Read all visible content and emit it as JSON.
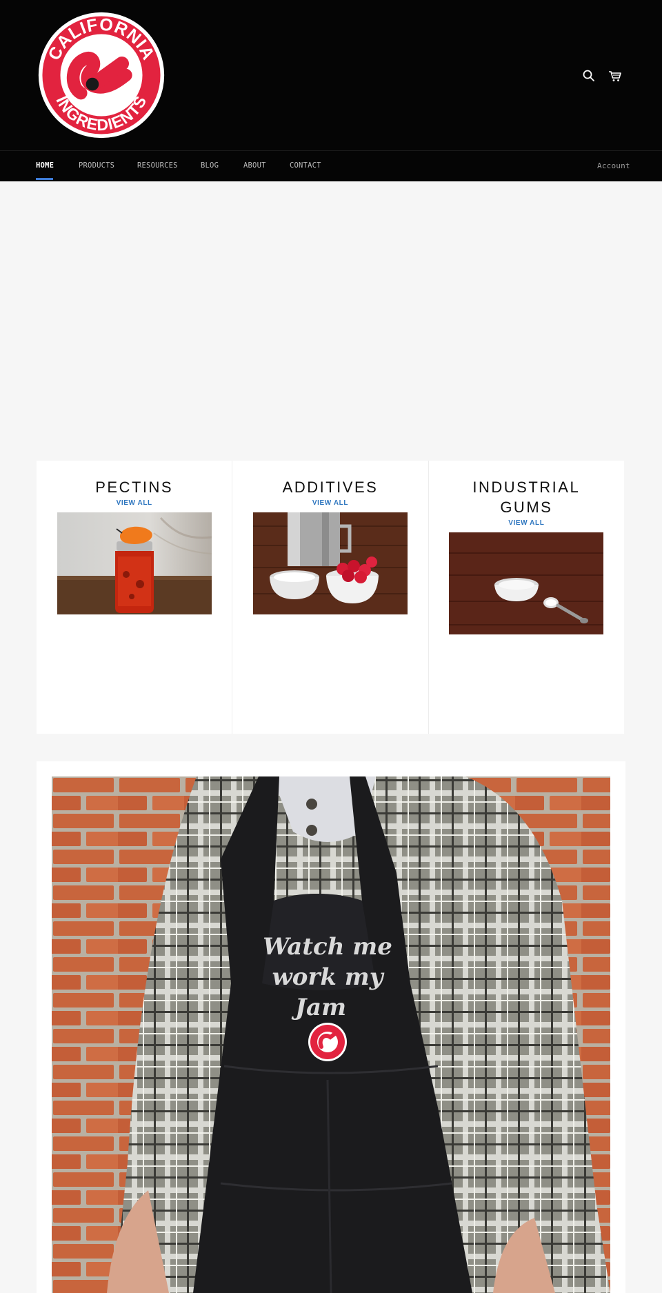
{
  "header": {
    "logo_alt": "California Ingredients",
    "logo_text_top": "CALIFORNIA",
    "logo_text_bottom": "INGREDIENTS",
    "icons": [
      "search-icon",
      "cart-icon"
    ]
  },
  "nav": {
    "items": [
      {
        "label": "HOME",
        "active": true
      },
      {
        "label": "PRODUCTS"
      },
      {
        "label": "RESOURCES"
      },
      {
        "label": "BLOG"
      },
      {
        "label": "ABOUT"
      },
      {
        "label": "CONTACT"
      }
    ],
    "account": "Account"
  },
  "collections": [
    {
      "title": "PECTINS",
      "link": "VIEW ALL"
    },
    {
      "title": "ADDITIVES",
      "link": "VIEW ALL"
    },
    {
      "title": "INDUSTRIAL GUMS",
      "link": "VIEW ALL"
    }
  ],
  "featured": {
    "apron_text": [
      "Watch me",
      "work my",
      "Jam"
    ]
  },
  "colors": {
    "brand_red": "#e2233f",
    "link_blue": "#2e76bf",
    "nav_accent": "#3d7bd6"
  }
}
